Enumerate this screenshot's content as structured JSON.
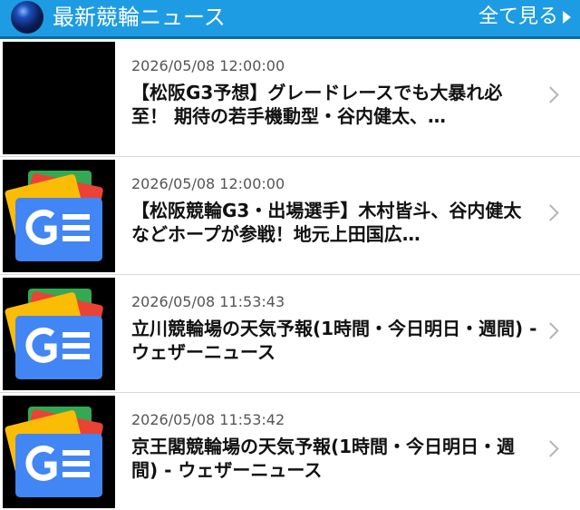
{
  "header": {
    "title": "最新競輪ニュース",
    "more_label": "全て見る",
    "colors": {
      "bar": "#1e9ce3",
      "border": "#0a6aa6"
    }
  },
  "news": [
    {
      "date": "2026/05/08 12:00:00",
      "headline": "【松阪G3予想】グレードレースでも大暴れ必至！ 期待の若手機動型・谷内健太、…",
      "thumb": "blank"
    },
    {
      "date": "2026/05/08 12:00:00",
      "headline": "【松阪競輪G3・出場選手】木村皆斗、谷内健太などホープが参戦！地元上田国広…",
      "thumb": "google-news-icon"
    },
    {
      "date": "2026/05/08 11:53:43",
      "headline": "立川競輪場の天気予報(1時間・今日明日・週間) - ウェザーニュース",
      "thumb": "google-news-icon"
    },
    {
      "date": "2026/05/08 11:53:42",
      "headline": "京王閣競輪場の天気予報(1時間・今日明日・週間) - ウェザーニュース",
      "thumb": "google-news-icon"
    }
  ]
}
